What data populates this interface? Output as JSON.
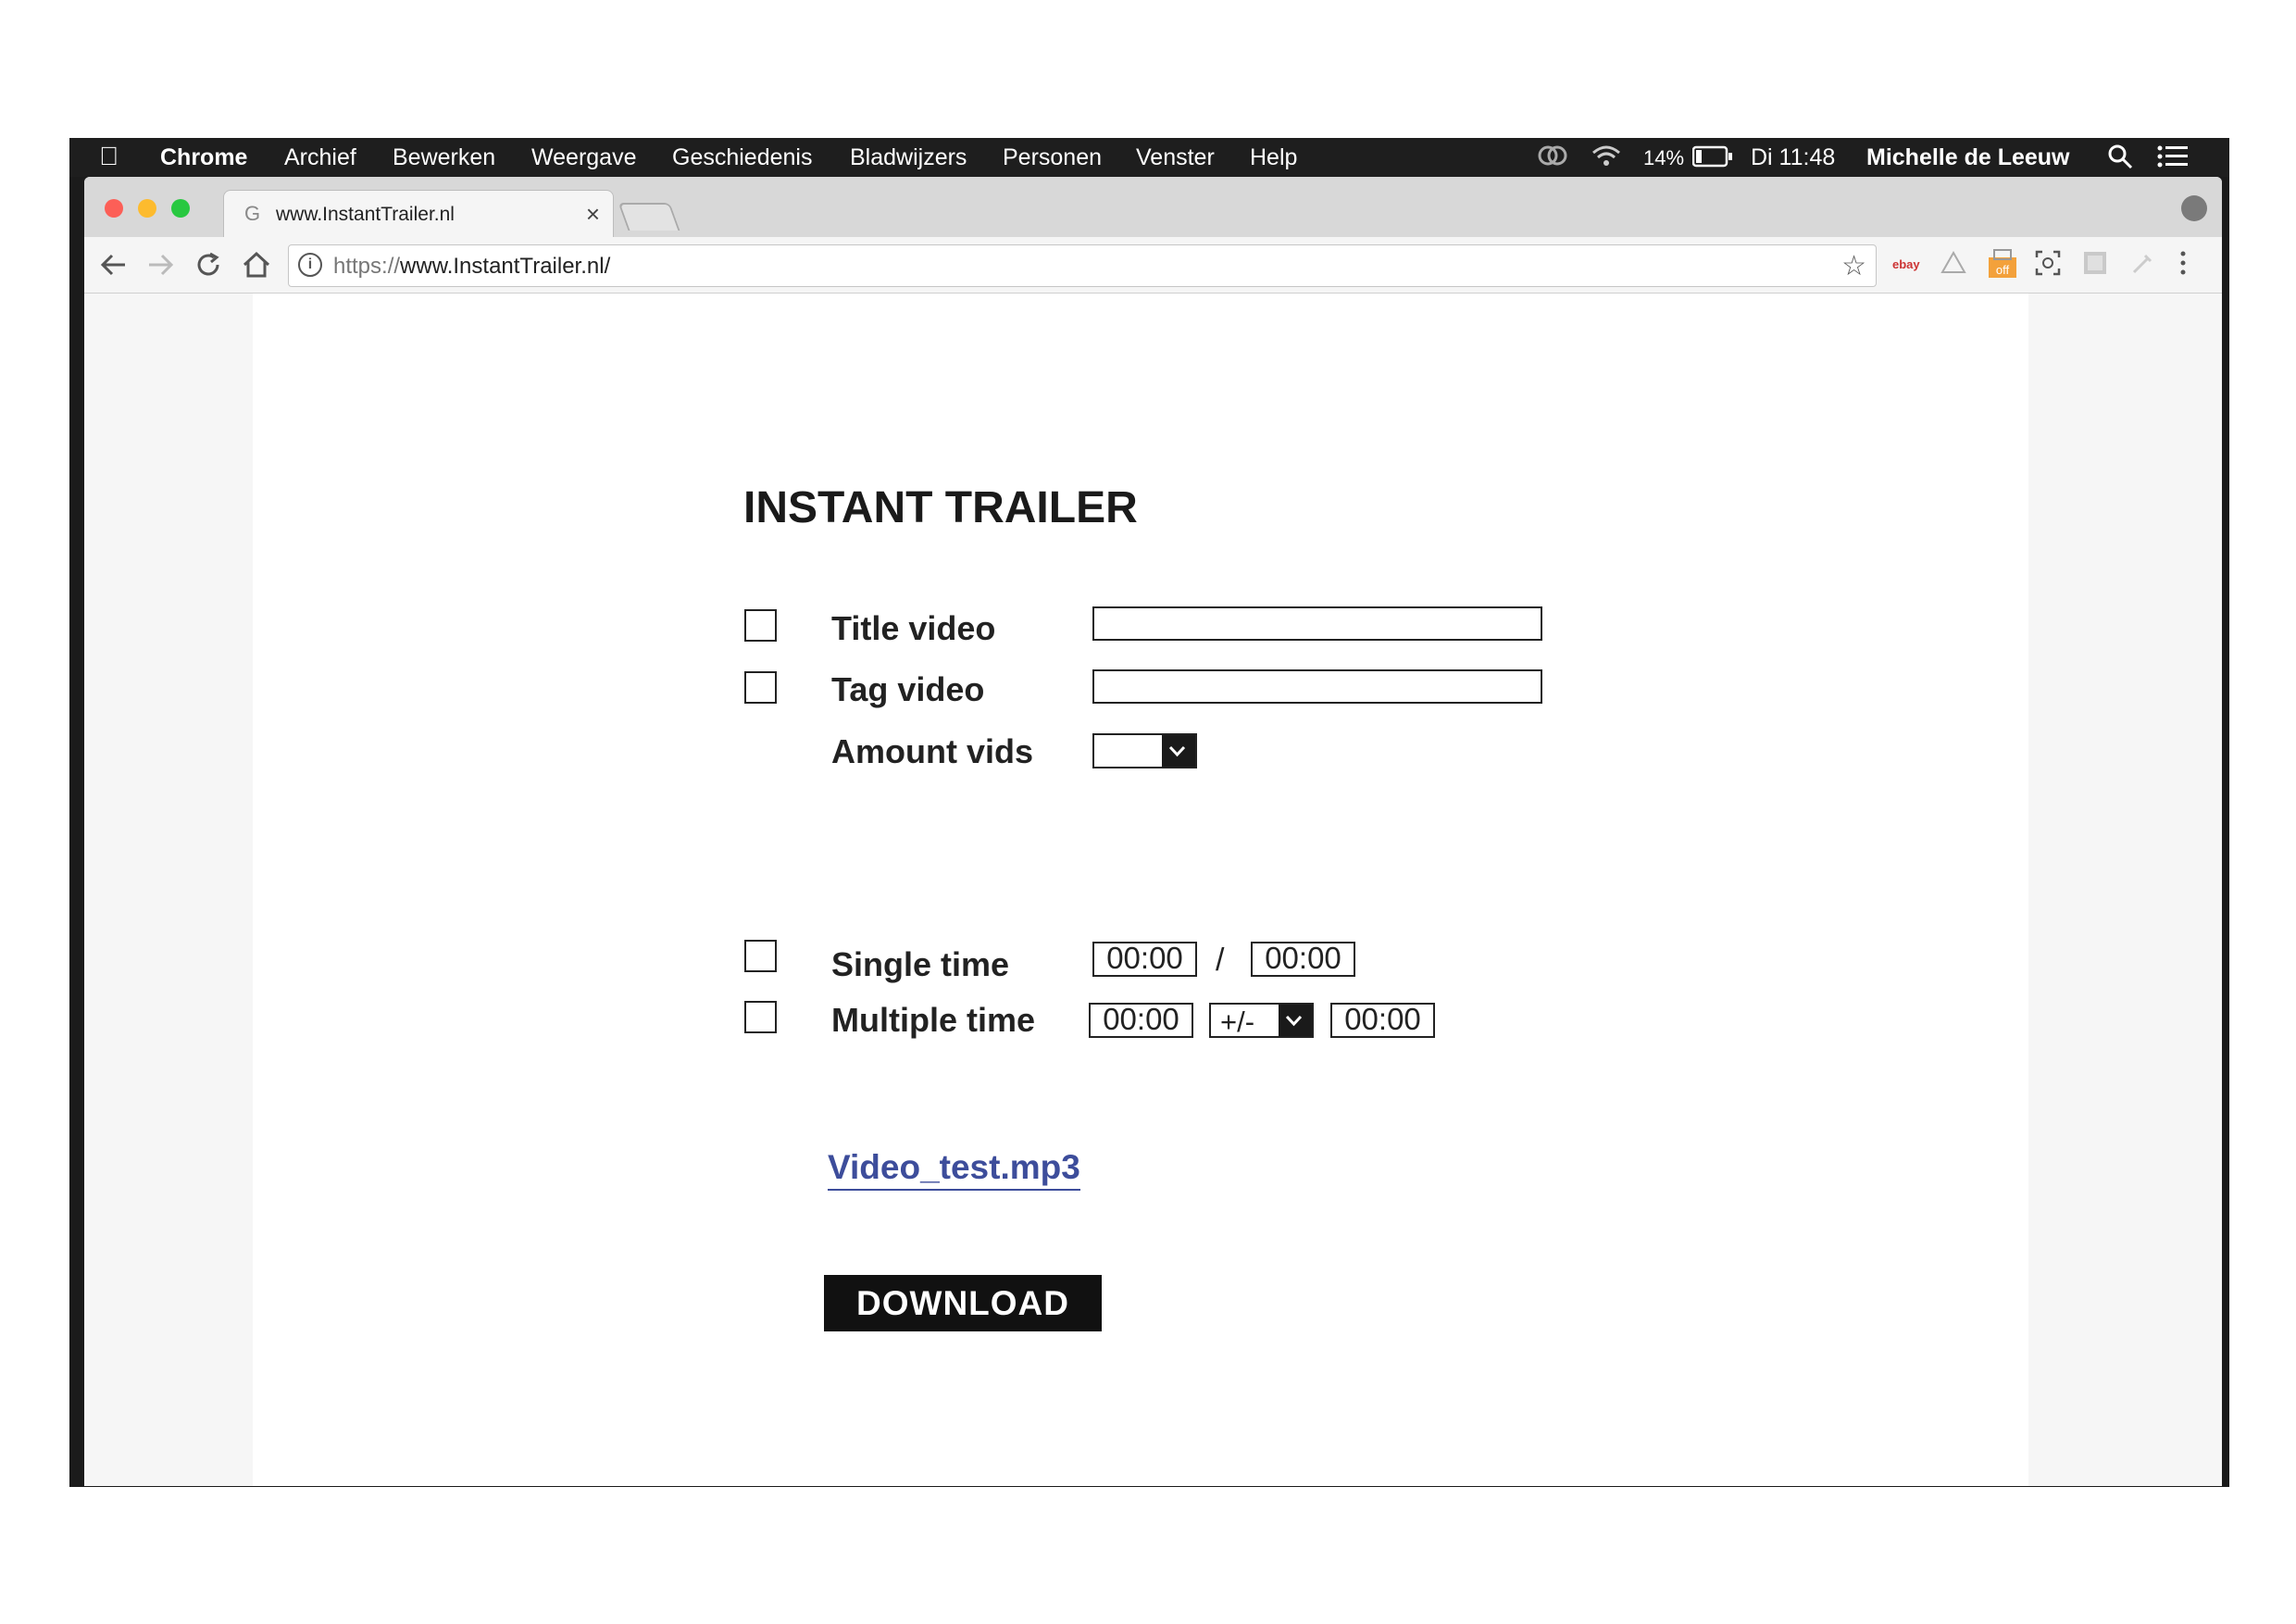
{
  "menubar": {
    "app": "Chrome",
    "items": [
      "Archief",
      "Bewerken",
      "Weergave",
      "Geschiedenis",
      "Bladwijzers",
      "Personen",
      "Venster",
      "Help"
    ],
    "battery": "14%",
    "clock": "Di 11:48",
    "user": "Michelle de Leeuw"
  },
  "browser": {
    "tab_title": "www.InstantTrailer.nl",
    "tab_favicon": "G",
    "url_scheme": "https://",
    "url_host": "www.InstantTrailer.nl/",
    "extension_ebay": "ebay",
    "extension_off": "off"
  },
  "form": {
    "title": "INSTANT TRAILER",
    "title_video_label": "Title video",
    "title_video_value": "",
    "tag_video_label": "Tag video",
    "tag_video_value": "",
    "amount_label": "Amount vids",
    "amount_value": "",
    "single_time_label": "Single time",
    "single_start": "00:00",
    "single_sep": "/",
    "single_end": "00:00",
    "multiple_time_label": "Multiple time",
    "multiple_start": "00:00",
    "multiple_op": "+/-",
    "multiple_end": "00:00",
    "file_link": "Video_test.mp3",
    "download_label": "DOWNLOAD"
  },
  "colors": {
    "link": "#3d4d9b",
    "button": "#111111",
    "close_light": "#fc5f57",
    "minimize_light": "#fdbb2e",
    "zoom_light": "#28c840"
  }
}
